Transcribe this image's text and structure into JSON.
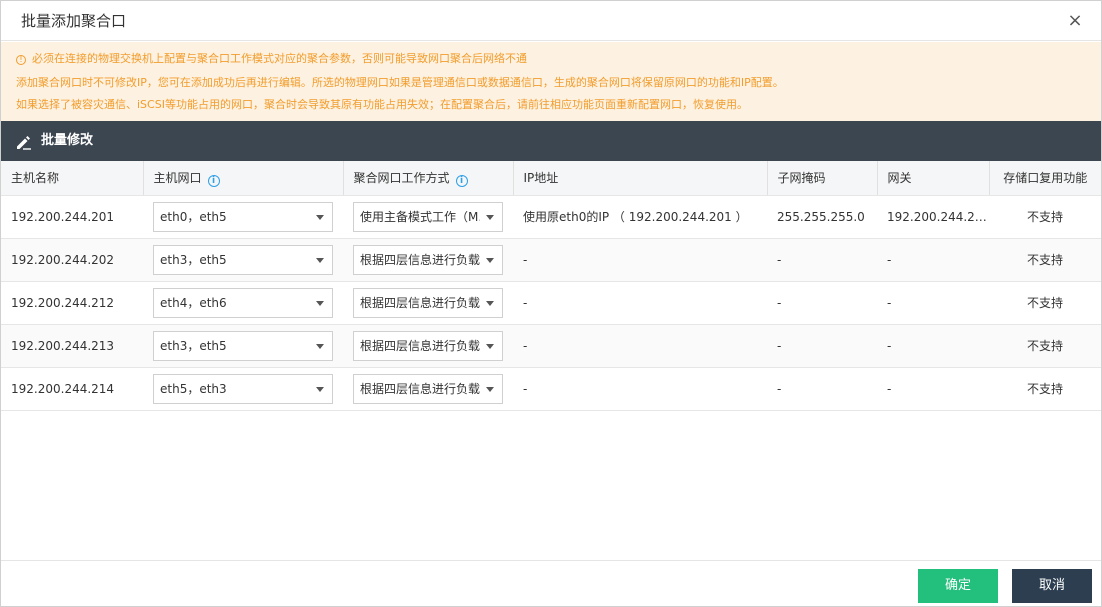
{
  "dialog": {
    "title": "批量添加聚合口",
    "close_glyph": "×"
  },
  "notice": {
    "icon_glyph": "!",
    "lines": [
      "必须在连接的物理交换机上配置与聚合口工作模式对应的聚合参数，否则可能导致网口聚合后网络不通",
      "添加聚合网口时不可修改IP，您可在添加成功后再进行编辑。所选的物理网口如果是管理通信口或数据通信口，生成的聚合网口将保留原网口的功能和IP配置。",
      "如果选择了被容灾通信、iSCSI等功能占用的网口，聚合时会导致其原有功能占用失效；在配置聚合后，请前往相应功能页面重新配置网口，恢复使用。"
    ]
  },
  "batch_bar": {
    "label": "批量修改"
  },
  "table": {
    "columns": [
      "主机名称",
      "主机网口",
      "聚合网口工作方式",
      "IP地址",
      "子网掩码",
      "网关",
      "存储口复用功能"
    ],
    "info_glyph": "i",
    "rows": [
      {
        "host": "192.200.244.201",
        "nics": "eth0，eth5",
        "mode": "使用主备模式工作（M…",
        "ip": "使用原eth0的IP （ 192.200.244.201 ）",
        "mask": "255.255.255.0",
        "gateway": "192.200.244.2…",
        "reuse": "不支持"
      },
      {
        "host": "192.200.244.202",
        "nics": "eth3，eth5",
        "mode": "根据四层信息进行负载",
        "ip": "-",
        "mask": "-",
        "gateway": "-",
        "reuse": "不支持"
      },
      {
        "host": "192.200.244.212",
        "nics": "eth4，eth6",
        "mode": "根据四层信息进行负载",
        "ip": "-",
        "mask": "-",
        "gateway": "-",
        "reuse": "不支持"
      },
      {
        "host": "192.200.244.213",
        "nics": "eth3，eth5",
        "mode": "根据四层信息进行负载",
        "ip": "-",
        "mask": "-",
        "gateway": "-",
        "reuse": "不支持"
      },
      {
        "host": "192.200.244.214",
        "nics": "eth5，eth3",
        "mode": "根据四层信息进行负载",
        "ip": "-",
        "mask": "-",
        "gateway": "-",
        "reuse": "不支持"
      }
    ]
  },
  "footer": {
    "ok_label": "确定",
    "cancel_label": "取消"
  },
  "colors": {
    "notice_text": "#f29c2b",
    "notice_bg": "#fdf2e2",
    "batch_bar_bg": "#3b4651",
    "ok_button": "#22c07c",
    "cancel_button": "#2c3e50",
    "info_icon": "#2fa0e8"
  },
  "icons": {
    "close": "close-icon",
    "warning": "warning-icon",
    "edit": "pencil-icon",
    "info": "info-icon",
    "dropdown": "chevron-down-icon"
  }
}
